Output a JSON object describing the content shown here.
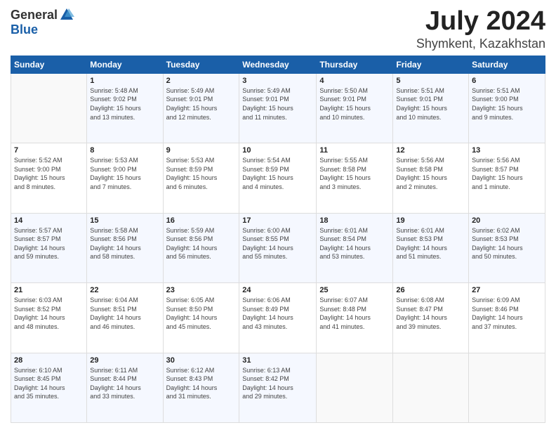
{
  "logo": {
    "general": "General",
    "blue": "Blue"
  },
  "title": "July 2024",
  "location": "Shymkent, Kazakhstan",
  "days_header": [
    "Sunday",
    "Monday",
    "Tuesday",
    "Wednesday",
    "Thursday",
    "Friday",
    "Saturday"
  ],
  "weeks": [
    [
      {
        "day": "",
        "info": ""
      },
      {
        "day": "1",
        "info": "Sunrise: 5:48 AM\nSunset: 9:02 PM\nDaylight: 15 hours\nand 13 minutes."
      },
      {
        "day": "2",
        "info": "Sunrise: 5:49 AM\nSunset: 9:01 PM\nDaylight: 15 hours\nand 12 minutes."
      },
      {
        "day": "3",
        "info": "Sunrise: 5:49 AM\nSunset: 9:01 PM\nDaylight: 15 hours\nand 11 minutes."
      },
      {
        "day": "4",
        "info": "Sunrise: 5:50 AM\nSunset: 9:01 PM\nDaylight: 15 hours\nand 10 minutes."
      },
      {
        "day": "5",
        "info": "Sunrise: 5:51 AM\nSunset: 9:01 PM\nDaylight: 15 hours\nand 10 minutes."
      },
      {
        "day": "6",
        "info": "Sunrise: 5:51 AM\nSunset: 9:00 PM\nDaylight: 15 hours\nand 9 minutes."
      }
    ],
    [
      {
        "day": "7",
        "info": "Sunrise: 5:52 AM\nSunset: 9:00 PM\nDaylight: 15 hours\nand 8 minutes."
      },
      {
        "day": "8",
        "info": "Sunrise: 5:53 AM\nSunset: 9:00 PM\nDaylight: 15 hours\nand 7 minutes."
      },
      {
        "day": "9",
        "info": "Sunrise: 5:53 AM\nSunset: 8:59 PM\nDaylight: 15 hours\nand 6 minutes."
      },
      {
        "day": "10",
        "info": "Sunrise: 5:54 AM\nSunset: 8:59 PM\nDaylight: 15 hours\nand 4 minutes."
      },
      {
        "day": "11",
        "info": "Sunrise: 5:55 AM\nSunset: 8:58 PM\nDaylight: 15 hours\nand 3 minutes."
      },
      {
        "day": "12",
        "info": "Sunrise: 5:56 AM\nSunset: 8:58 PM\nDaylight: 15 hours\nand 2 minutes."
      },
      {
        "day": "13",
        "info": "Sunrise: 5:56 AM\nSunset: 8:57 PM\nDaylight: 15 hours\nand 1 minute."
      }
    ],
    [
      {
        "day": "14",
        "info": "Sunrise: 5:57 AM\nSunset: 8:57 PM\nDaylight: 14 hours\nand 59 minutes."
      },
      {
        "day": "15",
        "info": "Sunrise: 5:58 AM\nSunset: 8:56 PM\nDaylight: 14 hours\nand 58 minutes."
      },
      {
        "day": "16",
        "info": "Sunrise: 5:59 AM\nSunset: 8:56 PM\nDaylight: 14 hours\nand 56 minutes."
      },
      {
        "day": "17",
        "info": "Sunrise: 6:00 AM\nSunset: 8:55 PM\nDaylight: 14 hours\nand 55 minutes."
      },
      {
        "day": "18",
        "info": "Sunrise: 6:01 AM\nSunset: 8:54 PM\nDaylight: 14 hours\nand 53 minutes."
      },
      {
        "day": "19",
        "info": "Sunrise: 6:01 AM\nSunset: 8:53 PM\nDaylight: 14 hours\nand 51 minutes."
      },
      {
        "day": "20",
        "info": "Sunrise: 6:02 AM\nSunset: 8:53 PM\nDaylight: 14 hours\nand 50 minutes."
      }
    ],
    [
      {
        "day": "21",
        "info": "Sunrise: 6:03 AM\nSunset: 8:52 PM\nDaylight: 14 hours\nand 48 minutes."
      },
      {
        "day": "22",
        "info": "Sunrise: 6:04 AM\nSunset: 8:51 PM\nDaylight: 14 hours\nand 46 minutes."
      },
      {
        "day": "23",
        "info": "Sunrise: 6:05 AM\nSunset: 8:50 PM\nDaylight: 14 hours\nand 45 minutes."
      },
      {
        "day": "24",
        "info": "Sunrise: 6:06 AM\nSunset: 8:49 PM\nDaylight: 14 hours\nand 43 minutes."
      },
      {
        "day": "25",
        "info": "Sunrise: 6:07 AM\nSunset: 8:48 PM\nDaylight: 14 hours\nand 41 minutes."
      },
      {
        "day": "26",
        "info": "Sunrise: 6:08 AM\nSunset: 8:47 PM\nDaylight: 14 hours\nand 39 minutes."
      },
      {
        "day": "27",
        "info": "Sunrise: 6:09 AM\nSunset: 8:46 PM\nDaylight: 14 hours\nand 37 minutes."
      }
    ],
    [
      {
        "day": "28",
        "info": "Sunrise: 6:10 AM\nSunset: 8:45 PM\nDaylight: 14 hours\nand 35 minutes."
      },
      {
        "day": "29",
        "info": "Sunrise: 6:11 AM\nSunset: 8:44 PM\nDaylight: 14 hours\nand 33 minutes."
      },
      {
        "day": "30",
        "info": "Sunrise: 6:12 AM\nSunset: 8:43 PM\nDaylight: 14 hours\nand 31 minutes."
      },
      {
        "day": "31",
        "info": "Sunrise: 6:13 AM\nSunset: 8:42 PM\nDaylight: 14 hours\nand 29 minutes."
      },
      {
        "day": "",
        "info": ""
      },
      {
        "day": "",
        "info": ""
      },
      {
        "day": "",
        "info": ""
      }
    ]
  ]
}
